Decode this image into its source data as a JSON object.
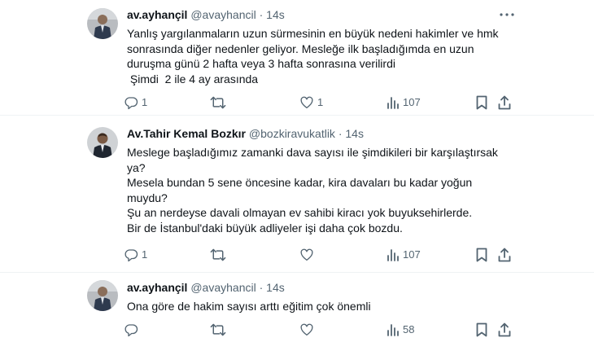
{
  "tweets": [
    {
      "name": "av.ayhançil",
      "handle": "@avayhancil",
      "dot": "·",
      "time": "14s",
      "lines": [
        "Yanlış yargılanmaların uzun sürmesinin en büyük nedeni hakimler ve hmk",
        "sonrasında diğer nedenler geliyor. Mesleğe ilk başladığımda en uzun",
        "duruşma günü 2 hafta veya 3 hafta sonrasına verilirdi",
        " Şimdi  2 ile 4 ay arasında"
      ],
      "replies": "1",
      "retweets": "",
      "likes": "1",
      "views": "107"
    },
    {
      "name": "Av.Tahir Kemal Bozkır",
      "handle": "@bozkiravukatlik",
      "dot": "·",
      "time": "14s",
      "lines": [
        "Meslege başladığımız zamanki dava sayısı ile şimdikileri bir karşılaştırsak",
        "ya?",
        "Mesela bundan 5 sene öncesine kadar, kira davaları bu kadar yoğun",
        "muydu?",
        "Şu an nerdeyse davali olmayan ev sahibi kiracı yok buyuksehirlerde.",
        "Bir de İstanbul'daki büyük adliyeler işi daha çok bozdu."
      ],
      "replies": "1",
      "retweets": "",
      "likes": "",
      "views": "107"
    },
    {
      "name": "av.ayhançil",
      "handle": "@avayhancil",
      "dot": "·",
      "time": "14s",
      "lines": [
        "Ona göre de hakim sayısı arttı eğitim çok önemli"
      ],
      "replies": "",
      "retweets": "",
      "likes": "",
      "views": "58"
    }
  ],
  "icons": {
    "more": "more-icon",
    "reply": "reply-icon",
    "retweet": "retweet-icon",
    "like": "like-icon",
    "views": "views-icon",
    "bookmark": "bookmark-icon",
    "share": "share-icon"
  },
  "colors": {
    "text": "#0f1419",
    "secondary": "#536471",
    "divider": "#eff3f4"
  }
}
